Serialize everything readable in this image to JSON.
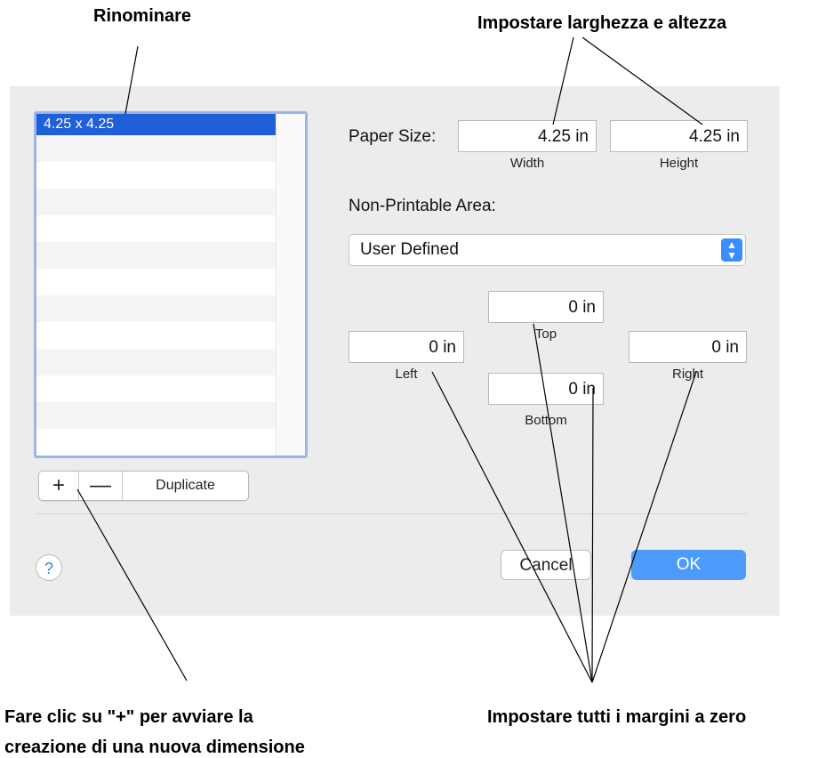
{
  "annotations": {
    "rename": "Rinominare",
    "set_width_height": "Impostare larghezza e altezza",
    "click_plus": "Fare clic su \"+\" per avviare la",
    "click_plus_line2": "creazione di una nuova dimensione",
    "set_margins_zero": "Impostare tutti i margini a zero"
  },
  "dialog": {
    "list": {
      "selected_item": "4.25 x 4.25"
    },
    "list_controls": {
      "add": "+",
      "remove": "—",
      "duplicate": "Duplicate"
    },
    "paper_size": {
      "label": "Paper Size:",
      "width_value": "4.25 in",
      "width_label": "Width",
      "height_value": "4.25 in",
      "height_label": "Height"
    },
    "non_printable": {
      "label": "Non-Printable Area:",
      "selected": "User Defined",
      "arrows_icon": "updown-arrows-icon"
    },
    "margins": {
      "top_value": "0 in",
      "top_label": "Top",
      "left_value": "0 in",
      "left_label": "Left",
      "bottom_value": "0 in",
      "bottom_label": "Bottom",
      "right_value": "0 in",
      "right_label": "Right"
    },
    "help": "?",
    "cancel": "Cancel",
    "ok": "OK"
  },
  "colors": {
    "selection": "#1f5fd7",
    "ok_button": "#4c9bfb",
    "dialog_bg": "#ececec"
  }
}
